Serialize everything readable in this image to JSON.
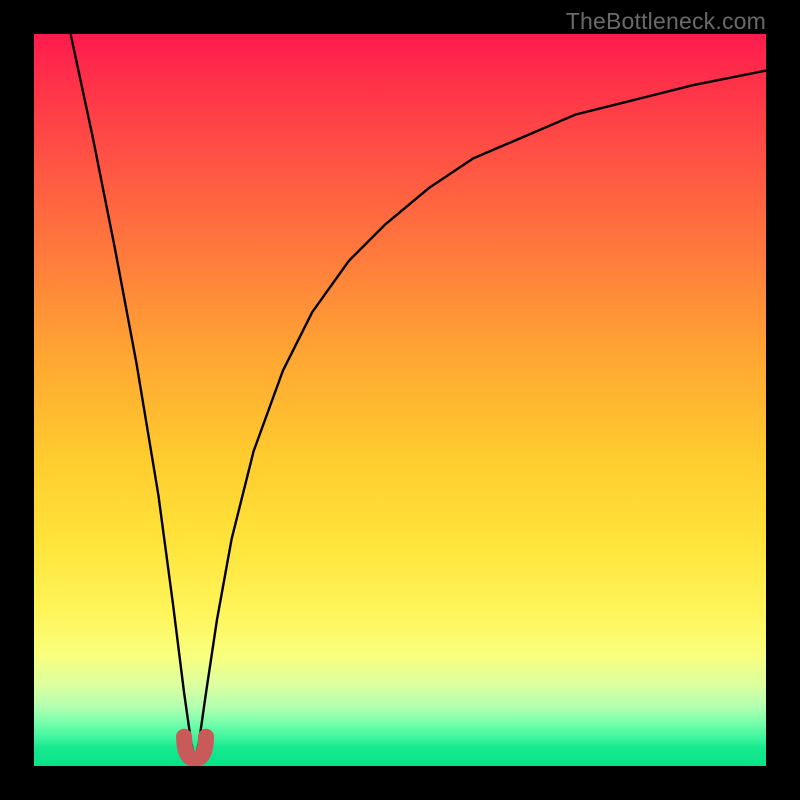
{
  "attribution": "TheBottleneck.com",
  "colors": {
    "gradient_top": "#ff1a4d",
    "gradient_bottom": "#09e288",
    "curve_stroke": "#000000",
    "marker_stroke": "#c85a5a",
    "background": "#000000"
  },
  "chart_data": {
    "type": "line",
    "title": "",
    "xlabel": "",
    "ylabel": "",
    "xlim": [
      0,
      100
    ],
    "ylim": [
      0,
      100
    ],
    "grid": false,
    "legend": false,
    "description": "Absolute-difference-style bottleneck curve: y = |f(x) - balance| with a single minimum (sweet spot) near x≈22 where value drops to ~0, rising steeply to the left and asymptotically toward ~95 to the right.",
    "series": [
      {
        "name": "bottleneck_percent",
        "x": [
          5,
          8,
          11,
          14,
          17,
          19,
          20.5,
          21.5,
          22,
          22.5,
          23.5,
          25,
          27,
          30,
          34,
          38,
          43,
          48,
          54,
          60,
          67,
          74,
          82,
          90,
          100
        ],
        "values": [
          100,
          86,
          71,
          55,
          37,
          22,
          10,
          3,
          1,
          3,
          10,
          20,
          31,
          43,
          54,
          62,
          69,
          74,
          79,
          83,
          86,
          89,
          91,
          93,
          95
        ]
      }
    ],
    "sweet_spot": {
      "x_range": [
        20.5,
        23.5
      ],
      "value_min": 1
    }
  }
}
